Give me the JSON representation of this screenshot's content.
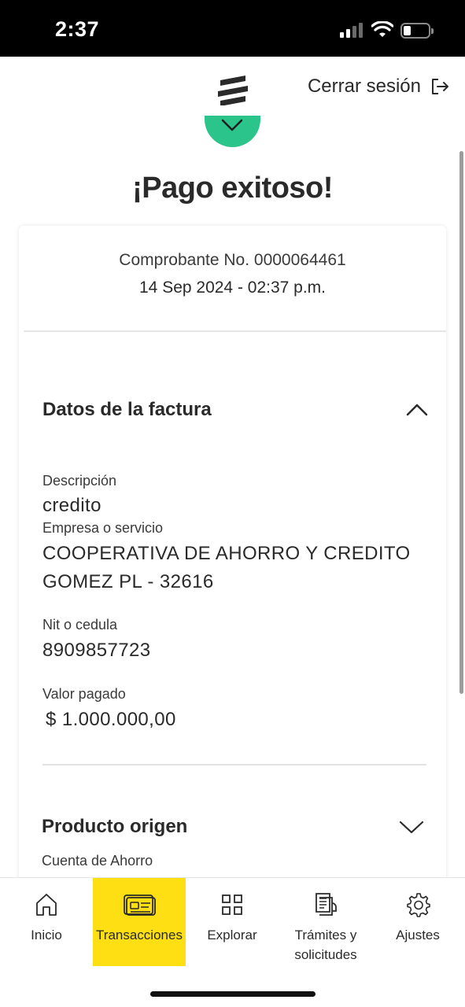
{
  "status_bar": {
    "time": "2:37"
  },
  "header": {
    "logout_label": "Cerrar sesión"
  },
  "title": "¡Pago exitoso!",
  "receipt": {
    "number": "Comprobante No. 0000064461",
    "date": "14 Sep 2024 - 02:37 p.m."
  },
  "invoice_section": {
    "title": "Datos de la factura",
    "fields": [
      {
        "label": "Descripción",
        "value": "credito"
      },
      {
        "label": "Empresa o servicio",
        "value_line1": "COOPERATIVA DE AHORRO Y CREDITO",
        "value_line2": "GOMEZ PL - 32616"
      },
      {
        "label": "Nit o cedula",
        "value": "8909857723"
      },
      {
        "label": "Valor pagado",
        "value": "$ 1.000.000,00"
      }
    ]
  },
  "origin_section": {
    "title": "Producto origen",
    "subtitle": "Cuenta de Ahorro"
  },
  "bottom_nav": {
    "items": [
      {
        "label": "Inicio",
        "icon": "home-icon"
      },
      {
        "label": "Transacciones",
        "icon": "transactions-icon",
        "active": true
      },
      {
        "label": "Explorar",
        "icon": "grid-icon"
      },
      {
        "label": "Trámites y solicitudes",
        "line1": "Trámites y",
        "line2": "solicitudes",
        "icon": "documents-icon"
      },
      {
        "label": "Ajustes",
        "icon": "gear-icon"
      }
    ]
  },
  "colors": {
    "accent_yellow": "#fddf13",
    "success_green": "#2bc48a"
  }
}
